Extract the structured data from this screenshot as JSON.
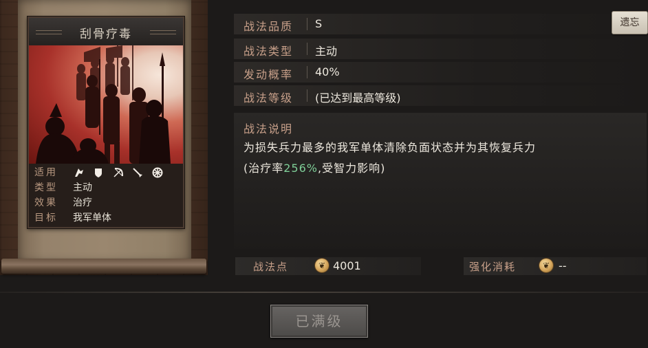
{
  "card": {
    "title": "刮骨疗毒",
    "info": {
      "applicable_label": "适用",
      "applicable_units": [
        "cavalry-icon",
        "shield-icon",
        "bow-icon",
        "spear-icon",
        "wheel-icon"
      ],
      "type_label": "类型",
      "type_value": "主动",
      "effect_label": "效果",
      "effect_value": "治疗",
      "target_label": "目标",
      "target_value": "我军单体"
    }
  },
  "details": {
    "quality_label": "战法品质",
    "quality_value": "S",
    "type_label": "战法类型",
    "type_value": "主动",
    "rate_label": "发动概率",
    "rate_value": "40%",
    "level_label": "战法等级",
    "level_value": "(已达到最高等级)"
  },
  "legacy_button": "遗忘",
  "description": {
    "title": "战法说明",
    "line1": "为损失兵力最多的我军单体清除负面状态并为其恢复兵力",
    "line2_prefix": "(治疗率",
    "line2_value": "256%",
    "line2_suffix": ",受智力影响)"
  },
  "points": {
    "label": "战法点",
    "value": "4001",
    "upgrade_cost_label": "强化消耗",
    "upgrade_cost_value": "--"
  },
  "maxed_button": "已满级",
  "colors": {
    "label_accent": "#c8a08a",
    "highlight_green": "#7fcf98",
    "coin_gold": "#d4a45a"
  }
}
